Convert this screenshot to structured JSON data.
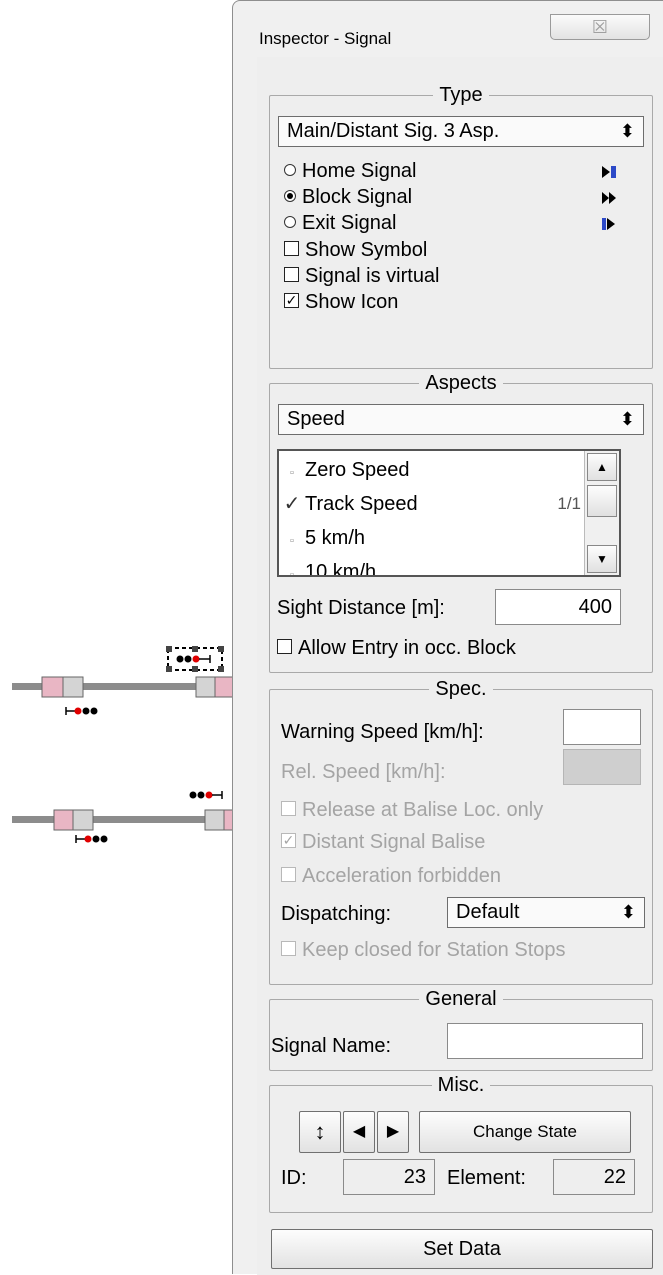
{
  "window": {
    "title": "Inspector - Signal",
    "close_glyph": "☒"
  },
  "type_group": {
    "legend": "Type",
    "signal_type": "Main/Distant Sig. 3 Asp.",
    "radios": [
      {
        "label": "Home Signal",
        "selected": false,
        "icon": "home-signal-icon"
      },
      {
        "label": "Block Signal",
        "selected": true,
        "icon": "block-signal-icon"
      },
      {
        "label": "Exit Signal",
        "selected": false,
        "icon": "exit-signal-icon"
      }
    ],
    "show_symbol": {
      "label": "Show Symbol",
      "checked": false
    },
    "signal_virtual": {
      "label": "Signal is virtual",
      "checked": false
    },
    "show_icon": {
      "label": "Show Icon",
      "checked": true
    }
  },
  "aspects_group": {
    "legend": "Aspects",
    "aspect_kind": "Speed",
    "items": [
      {
        "label": "Zero Speed",
        "checked": false,
        "counter": ""
      },
      {
        "label": "Track Speed",
        "checked": true,
        "counter": "1/1"
      },
      {
        "label": "5 km/h",
        "checked": false,
        "counter": ""
      },
      {
        "label": "10 km/h",
        "checked": false,
        "counter": ""
      }
    ],
    "sight_distance_label": "Sight Distance [m]:",
    "sight_distance_value": "400",
    "allow_entry": {
      "label": "Allow Entry in occ. Block",
      "checked": false
    }
  },
  "spec_group": {
    "legend": "Spec.",
    "warning_speed_label": "Warning Speed [km/h]:",
    "warning_speed_value": "",
    "rel_speed_label": "Rel. Speed [km/h]:",
    "rel_speed_value": "",
    "release_at_balise": {
      "label": "Release at Balise Loc. only",
      "checked": false
    },
    "distant_signal_balise": {
      "label": "Distant Signal Balise",
      "checked": true
    },
    "acceleration_forbidden": {
      "label": "Acceleration forbidden",
      "checked": false
    },
    "dispatching_label": "Dispatching:",
    "dispatching_value": "Default",
    "keep_closed": {
      "label": "Keep closed for Station Stops",
      "checked": false
    }
  },
  "general_group": {
    "legend": "General",
    "signal_name_label": "Signal Name:",
    "signal_name_value": ""
  },
  "misc_group": {
    "legend": "Misc.",
    "flip_glyph": "↕",
    "left_glyph": "◀",
    "right_glyph": "▶",
    "change_state_label": "Change State",
    "id_label": "ID:",
    "id_value": "23",
    "element_label": "Element:",
    "element_value": "22"
  },
  "set_data_label": "Set Data",
  "colors": {
    "track": "#8c8c8c",
    "signal_block": "#e9b6c4",
    "signal_gray": "#c9c9c9",
    "signal_red": "#e00000",
    "icon_blue": "#2c49c7"
  }
}
